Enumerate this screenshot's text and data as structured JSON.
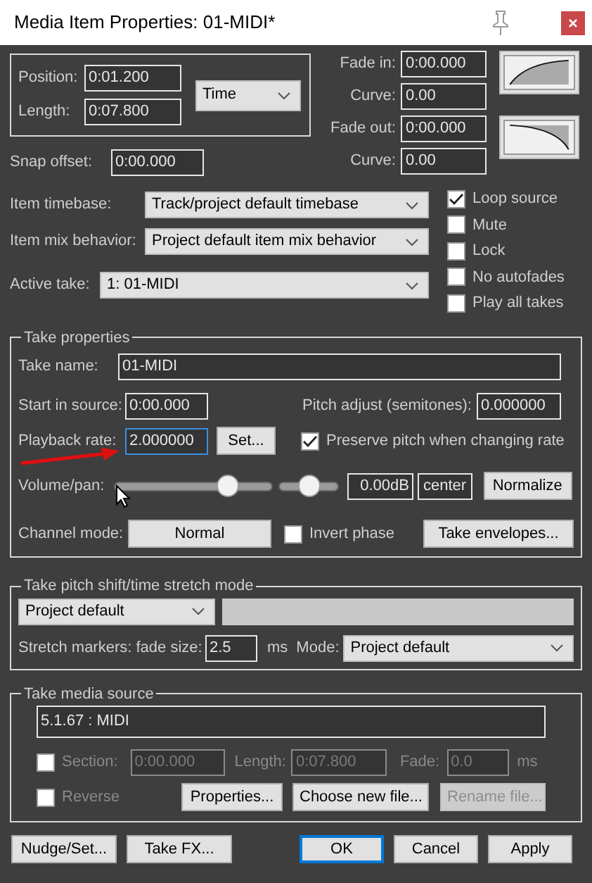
{
  "window": {
    "title": "Media Item Properties:  01-MIDI*"
  },
  "position": {
    "label": "Position:",
    "value": "0:01.200"
  },
  "length": {
    "label": "Length:",
    "value": "0:07.800"
  },
  "time_format": {
    "value": "Time"
  },
  "fades": [
    {
      "kind": "in",
      "label": "Fade in:",
      "value": "0:00.000",
      "curve_label": "Curve:",
      "curve": "0.00"
    },
    {
      "kind": "out",
      "label": "Fade out:",
      "value": "0:00.000",
      "curve_label": "Curve:",
      "curve": "0.00"
    }
  ],
  "snap_offset": {
    "label": "Snap offset:",
    "value": "0:00.000"
  },
  "item_settings": [
    {
      "label": "Item timebase:",
      "value": "Track/project default timebase"
    },
    {
      "label": "Item mix behavior:",
      "value": "Project default item mix behavior"
    },
    {
      "label": "Active take:",
      "value": "1: 01-MIDI"
    }
  ],
  "item_flags": [
    {
      "label": "Loop source",
      "checked": true
    },
    {
      "label": "Mute",
      "checked": false
    },
    {
      "label": "Lock",
      "checked": false
    },
    {
      "label": "No autofades",
      "checked": false
    },
    {
      "label": "Play all takes",
      "checked": false
    }
  ],
  "take_properties": {
    "title": "Take properties",
    "take_name": {
      "label": "Take name:",
      "value": "01-MIDI"
    },
    "start_in_source": {
      "label": "Start in source:",
      "value": "0:00.000"
    },
    "pitch_adjust": {
      "label": "Pitch adjust (semitones):",
      "value": "0.000000"
    },
    "playback_rate": {
      "label": "Playback rate:",
      "value": "2.000000",
      "focused": true
    },
    "set_button": "Set...",
    "preserve_pitch": {
      "label": "Preserve pitch when changing rate",
      "checked": true
    },
    "volume_pan": {
      "label": "Volume/pan:",
      "volume": {
        "level": 0.72
      },
      "pan": {
        "level": 0.5
      },
      "volume_reading": "0.00dB",
      "pan_reading": "center"
    },
    "normalize": "Normalize",
    "channel_mode": {
      "label": "Channel mode:",
      "value": "Normal"
    },
    "invert_phase": {
      "label": "Invert phase",
      "checked": false
    },
    "take_envelopes": "Take envelopes..."
  },
  "stretch": {
    "title": "Take pitch shift/time stretch mode",
    "algorithm": "Project default",
    "markers_label": "Stretch markers: fade size:",
    "fade_size": "2.5",
    "unit": "ms",
    "mode_label": "Mode:",
    "mode": "Project default"
  },
  "media_source": {
    "title": "Take media source",
    "source": "5.1.67 : MIDI",
    "section": {
      "label": "Section:",
      "checked": false,
      "disabled": true,
      "value": "0:00.000"
    },
    "length": {
      "label": "Length:",
      "value": "0:07.800",
      "disabled": true
    },
    "fade": {
      "label": "Fade:",
      "value": "0.0",
      "unit": "ms",
      "disabled": true
    },
    "reverse": {
      "label": "Reverse",
      "checked": false,
      "disabled": true
    },
    "buttons": [
      {
        "label": "Properties...",
        "disabled": false
      },
      {
        "label": "Choose new file...",
        "disabled": false
      },
      {
        "label": "Rename file...",
        "disabled": true
      }
    ]
  },
  "buttons": [
    {
      "label": "Nudge/Set...",
      "default": false
    },
    {
      "label": "Take FX...",
      "default": false
    },
    {
      "label": "OK",
      "default": true
    },
    {
      "label": "Cancel",
      "default": false
    },
    {
      "label": "Apply",
      "default": false
    }
  ]
}
